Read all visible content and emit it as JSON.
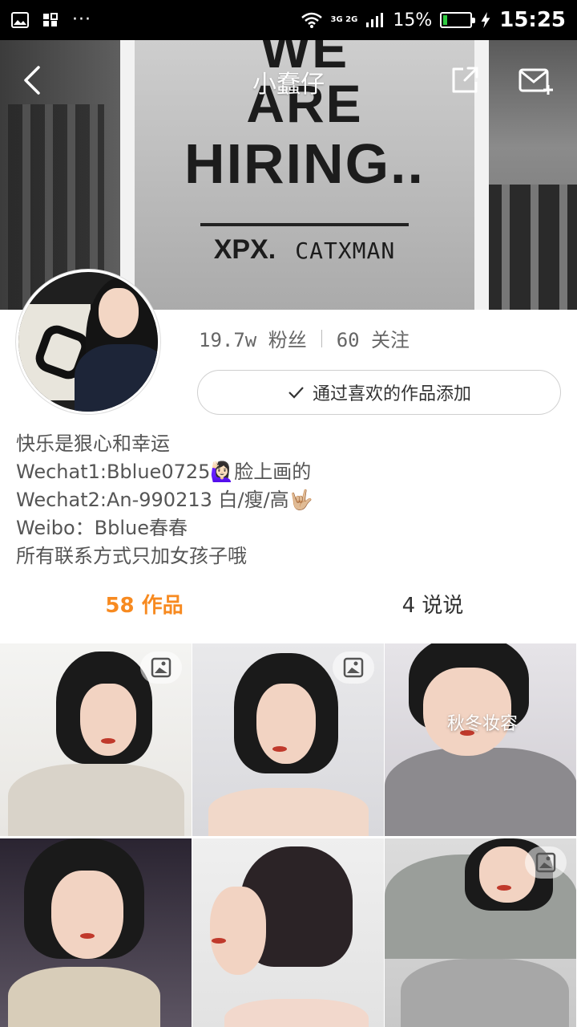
{
  "status_bar": {
    "network": "3G 2G",
    "battery": "15%",
    "battery_level": 0.15,
    "time": "15:25",
    "icons": [
      "image-icon",
      "apps-icon",
      "more-dots-icon",
      "wifi-icon",
      "signal-icon",
      "battery-icon",
      "charging-icon"
    ]
  },
  "header": {
    "title": "小蠢仔",
    "poster": {
      "line1": "WE",
      "line2": "ARE",
      "line3": "HIRING..",
      "brand1": "XPX.",
      "brand2": "CATXMAN"
    }
  },
  "profile": {
    "stats": {
      "fans": "19.7w 粉丝",
      "following": "60 关注"
    },
    "follow_button": "通过喜欢的作品添加",
    "bio": [
      "快乐是狠心和幸运",
      "Wechat1:Bblue0725🙋🏻‍♀️脸上画的",
      "Wechat2:An-990213 白/瘦/高🤟🏼",
      "Weibo：Bblue春春",
      "所有联系方式只加女孩子哦"
    ]
  },
  "tabs": [
    {
      "label": "58 作品",
      "active": true
    },
    {
      "label": "4 说说",
      "active": false
    }
  ],
  "accent_color": "#f78a20",
  "grid": {
    "captions": [
      "",
      "",
      "秋冬妆容",
      "",
      "",
      ""
    ]
  }
}
